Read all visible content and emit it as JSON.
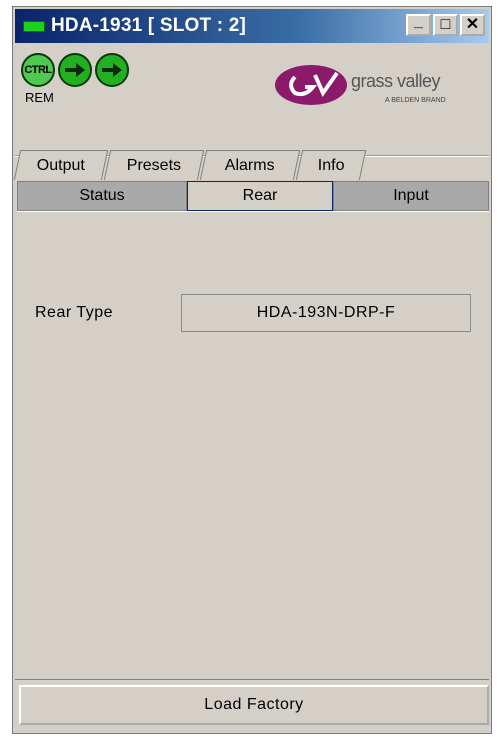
{
  "window": {
    "title": "HDA-1931 [ SLOT : 2]",
    "controls": {
      "minimize": "_",
      "maximize": "□",
      "close": "✕"
    }
  },
  "status": {
    "ctrl_label": "CTRL",
    "rem_label": "REM",
    "icons": [
      "ctrl-status-icon",
      "arrow-right-icon",
      "arrow-right-icon"
    ],
    "color": "#22b022"
  },
  "logo": {
    "brand": "grass valley",
    "tagline": "A BELDEN BRAND",
    "color": "#8b1a6b"
  },
  "tabs": {
    "back_row": [
      "Output",
      "Presets",
      "Alarms",
      "Info"
    ],
    "front_row": [
      "Status",
      "Rear",
      "Input"
    ],
    "active": "Rear"
  },
  "rear_panel": {
    "rear_type_label": "Rear Type",
    "rear_type_value": "HDA-193N-DRP-F"
  },
  "footer": {
    "load_factory_label": "Load Factory"
  }
}
